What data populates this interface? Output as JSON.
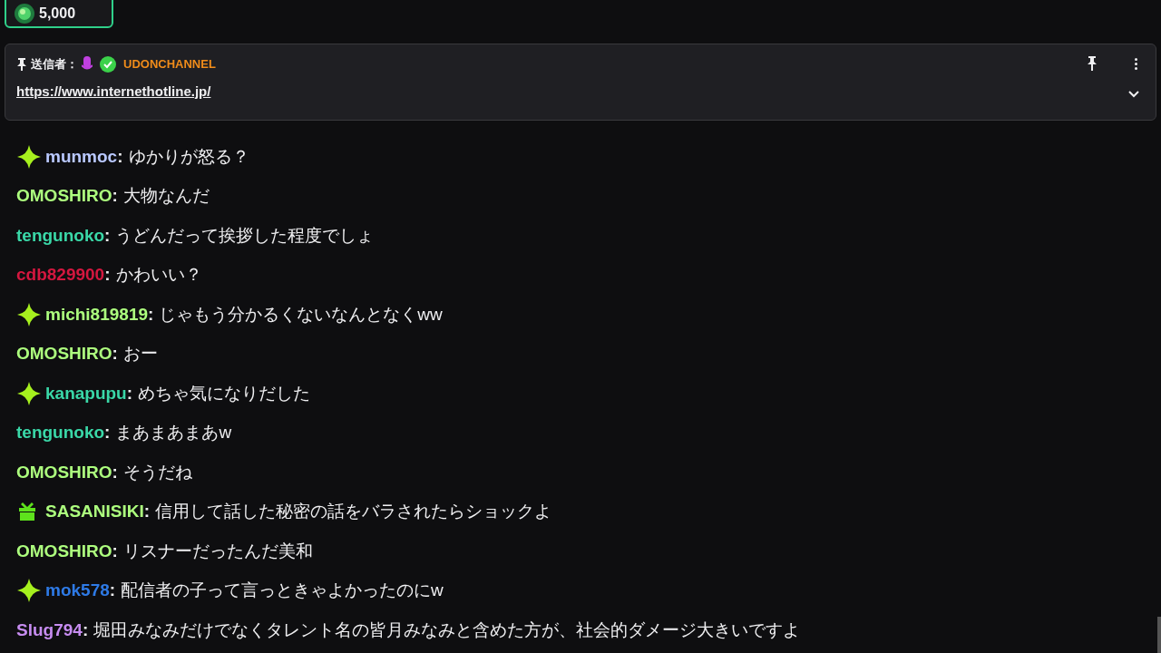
{
  "points": {
    "amount": "5,000"
  },
  "pinned": {
    "label": "送信者：",
    "sender": "UDONCHANNEL",
    "link": "https://www.internethotline.jp/"
  },
  "name_separator": ":",
  "messages": [
    {
      "kind": "sparkle",
      "user": "munmoc",
      "color": "#b9c8ff",
      "text": "ゆかりが怒る？"
    },
    {
      "kind": "plain",
      "user": "OMOSHIRO",
      "color": "#adff7e",
      "text": "大物なんだ"
    },
    {
      "kind": "plain",
      "user": "tengunoko",
      "color": "#3ad8a8",
      "text": "うどんだって挨拶した程度でしょ"
    },
    {
      "kind": "plain",
      "user": "cdb829900",
      "color": "#d4173f",
      "text": "かわいい？"
    },
    {
      "kind": "sparkle",
      "user": "michi819819",
      "color": "#adff7e",
      "text": "じゃもう分かるくないなんとなくww"
    },
    {
      "kind": "plain",
      "user": "OMOSHIRO",
      "color": "#adff7e",
      "text": "おー"
    },
    {
      "kind": "sparkle",
      "user": "kanapupu",
      "color": "#3ad8a8",
      "text": "めちゃ気になりだした"
    },
    {
      "kind": "plain",
      "user": "tengunoko",
      "color": "#3ad8a8",
      "text": "まあまあまあw"
    },
    {
      "kind": "plain",
      "user": "OMOSHIRO",
      "color": "#adff7e",
      "text": "そうだね"
    },
    {
      "kind": "gift",
      "user": "SASANISIKI",
      "color": "#adff7e",
      "text": "信用して話した秘密の話をバラされたらショックよ"
    },
    {
      "kind": "plain",
      "user": "OMOSHIRO",
      "color": "#adff7e",
      "text": "リスナーだったんだ美和"
    },
    {
      "kind": "sparkle",
      "user": "mok578",
      "color": "#2e7ae6",
      "text": "配信者の子って言っときゃよかったのにw"
    },
    {
      "kind": "plain",
      "user": "Slug794",
      "color": "#c68cf0",
      "text": "堀田みなみだけでなくタレント名の皆月みなみと含めた方が、社会的ダメージ大きいですよ"
    }
  ]
}
